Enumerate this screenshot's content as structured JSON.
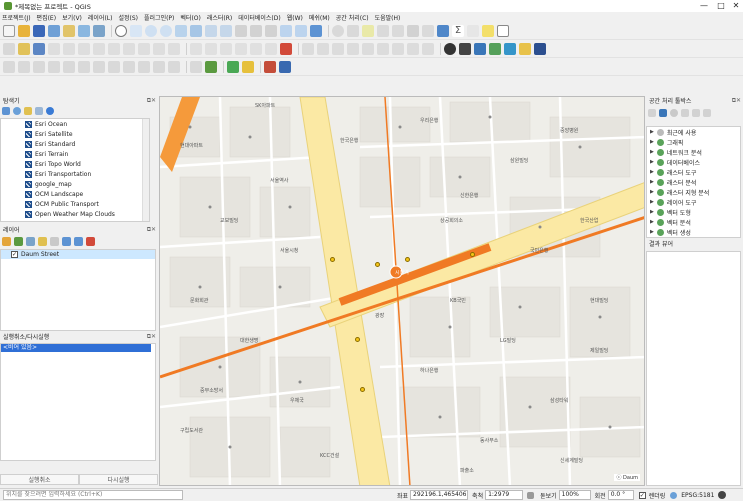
{
  "window": {
    "title": "*제목없는 프로젝트 - QGIS",
    "controls": [
      "—",
      "□",
      "✕"
    ]
  },
  "menu": [
    "프로젝트(J)",
    "편집(E)",
    "보기(V)",
    "레이어(L)",
    "설정(S)",
    "플러그인(P)",
    "벡터(O)",
    "래스터(R)",
    "데이터베이스(D)",
    "웹(W)",
    "메쉬(M)",
    "공간 처리(C)",
    "도움말(H)"
  ],
  "browser": {
    "title": "탐색기",
    "items": [
      "Esri Ocean",
      "Esri Satellite",
      "Esri Standard",
      "Esri Terrain",
      "Esri Topo World",
      "Esri Transportation",
      "google_map",
      "OCM Landscape",
      "OCM Public Transport",
      "Open Weather Map Clouds"
    ]
  },
  "layers": {
    "title": "레이어",
    "items": [
      {
        "name": "Daum Street",
        "checked": true
      }
    ]
  },
  "log": {
    "title": "실행취소/다시실행",
    "entry": "<비어 있음>",
    "tabs": [
      "실행취소",
      "다시실행"
    ]
  },
  "processing": {
    "title": "공간 처리 툴박스",
    "items": [
      "최근에 사용",
      "그래픽",
      "네트워크 분석",
      "데이터베이스",
      "래스터 도구",
      "래스터 분석",
      "래스터 지형 분석",
      "레이어 도구",
      "벡터 도형",
      "벡터 분석",
      "벡터 생성"
    ]
  },
  "results": {
    "title": "결과 뷰어"
  },
  "map": {
    "labels": [
      "SK아파트",
      "현대아파트",
      "한국은행",
      "우리은행",
      "중앙병원",
      "시청역",
      "교보빌딩",
      "신한은행",
      "국민은행",
      "KB국민",
      "KCC건설",
      "삼성타워",
      "하나은행",
      "문화회관",
      "서울시청",
      "상공회의소",
      "한국산업",
      "제일빌딩",
      "LG빌딩",
      "대한생명",
      "우체국",
      "구립도서관",
      "동사무소",
      "광장",
      "삼원빌딩",
      "서울역사",
      "중부소방서",
      "현대빌딩",
      "파출소",
      "신세계빌딩"
    ],
    "badge": "ⓒ Daum"
  },
  "status": {
    "search_placeholder": "위치를 찾으려면 입력하세요 (Ctrl+K)",
    "coord_label": "좌표",
    "coord": "292196.1,465406.5",
    "scale_label": "축척",
    "scale": "1:2979",
    "magnifier_label": "돋보기",
    "magnifier": "100%",
    "rotation_label": "회전",
    "rotation": "0.0 °",
    "render_label": "렌더링",
    "crs": "EPSG:5181"
  },
  "colors": {
    "arterial": "#fbe9a4",
    "arterial_border": "#e9d27a",
    "rail": "#f07a24",
    "river": "#f59a3b",
    "blocks": "#e6e4de"
  }
}
